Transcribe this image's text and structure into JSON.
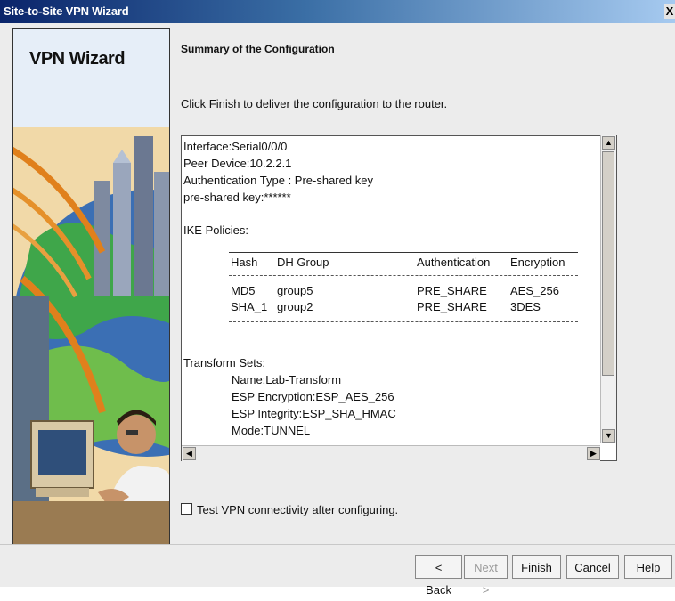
{
  "window": {
    "title": "Site-to-Site VPN Wizard",
    "close_label": "X"
  },
  "banner": {
    "title": "VPN Wizard"
  },
  "content": {
    "heading": "Summary of the Configuration",
    "instruction": "Click Finish to deliver the configuration to the router."
  },
  "summary": {
    "lines": [
      "Interface:Serial0/0/0",
      "Peer Device:10.2.2.1",
      "Authentication Type : Pre-shared key",
      "pre-shared key:******"
    ],
    "ike_label": "IKE Policies:",
    "ike_headers": [
      "Hash",
      "DH Group",
      "Authentication",
      "Encryption"
    ],
    "ike_rows": [
      [
        "MD5",
        "group5",
        "PRE_SHARE",
        "AES_256"
      ],
      [
        "SHA_1",
        "group2",
        "PRE_SHARE",
        "3DES"
      ]
    ],
    "transform_label": "Transform Sets:",
    "transform_lines": [
      "Name:Lab-Transform",
      "ESP Encryption:ESP_AES_256",
      "ESP Integrity:ESP_SHA_HMAC",
      "Mode:TUNNEL"
    ]
  },
  "checkbox": {
    "label": "Test VPN connectivity after configuring.",
    "checked": false
  },
  "buttons": {
    "back": "< Back",
    "next": "Next >",
    "finish": "Finish",
    "cancel": "Cancel",
    "help": "Help"
  },
  "colors": {
    "title_bar": "#0a246a",
    "window_bg": "#ececec"
  }
}
